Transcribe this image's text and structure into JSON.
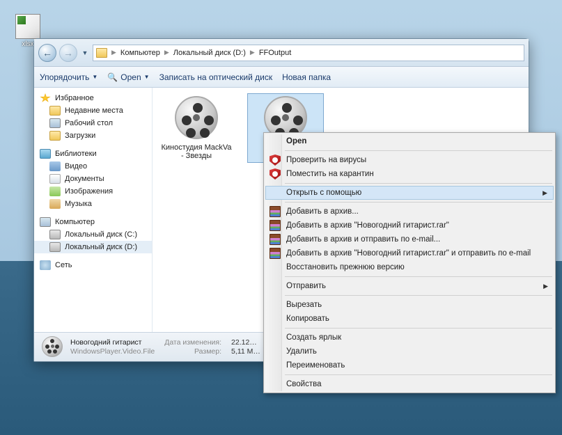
{
  "desktop": {
    "icon_label": "xlsx"
  },
  "breadcrumb": {
    "c0": "Компьютер",
    "c1": "Локальный диск (D:)",
    "c2": "FFOutput"
  },
  "toolbar": {
    "organize": "Упорядочить",
    "open": "Open",
    "burn": "Записать на оптический диск",
    "newfolder": "Новая папка"
  },
  "sidebar": {
    "fav": "Избранное",
    "recent": "Недавние места",
    "desktop": "Рабочий стол",
    "downloads": "Загрузки",
    "lib": "Библиотеки",
    "video": "Видео",
    "docs": "Документы",
    "images": "Изображения",
    "music": "Музыка",
    "comp": "Компьютер",
    "diskC": "Локальный диск (C:)",
    "diskD": "Локальный диск (D:)",
    "net": "Сеть"
  },
  "files": {
    "f0": "Киностудия MackVa - Звезды",
    "f1": "Новогодний гитарист"
  },
  "status": {
    "name": "Новогодний гитарист",
    "type": "WindowsPlayer.Video.File",
    "mod_label": "Дата изменения:",
    "mod_val": "22.12…",
    "size_label": "Размер:",
    "size_val": "5,11 М…"
  },
  "menu": {
    "open": "Open",
    "scan": "Проверить на вирусы",
    "quarantine": "Поместить на карантин",
    "openwith": "Открыть с помощью",
    "add_archive": "Добавить в архив...",
    "add_named": "Добавить в архив \"Новогодний гитарист.rar\"",
    "add_email": "Добавить в архив и отправить по e-mail...",
    "add_named_email": "Добавить в архив \"Новогодний гитарист.rar\" и отправить по e-mail",
    "restore": "Восстановить прежнюю версию",
    "send": "Отправить",
    "cut": "Вырезать",
    "copy": "Копировать",
    "shortcut": "Создать ярлык",
    "delete": "Удалить",
    "rename": "Переименовать",
    "props": "Свойства"
  }
}
